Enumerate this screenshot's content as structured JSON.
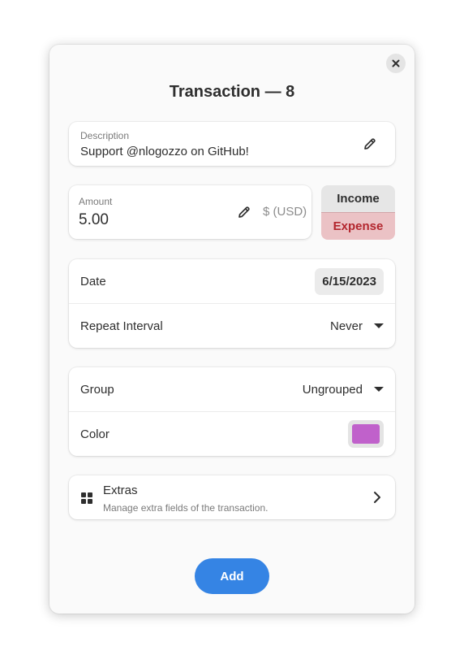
{
  "dialog": {
    "title": "Transaction — 8"
  },
  "description": {
    "label": "Description",
    "value": "Support @nlogozzo on GitHub!"
  },
  "amount": {
    "label": "Amount",
    "value": "5.00",
    "currency": "$ (USD)"
  },
  "type_toggle": {
    "income_label": "Income",
    "expense_label": "Expense",
    "selected": "Expense"
  },
  "date_section": {
    "date_label": "Date",
    "date_value": "6/15/2023",
    "repeat_label": "Repeat Interval",
    "repeat_value": "Never"
  },
  "group_section": {
    "group_label": "Group",
    "group_value": "Ungrouped",
    "color_label": "Color",
    "color_value": "#c061cb"
  },
  "extras": {
    "title": "Extras",
    "subtitle": "Manage extra fields of the transaction.",
    "icon": "grid-icon"
  },
  "actions": {
    "add_label": "Add"
  },
  "colors": {
    "accent": "#3584e4",
    "expense_bg": "#ebc2c5",
    "expense_text": "#b3262e"
  }
}
